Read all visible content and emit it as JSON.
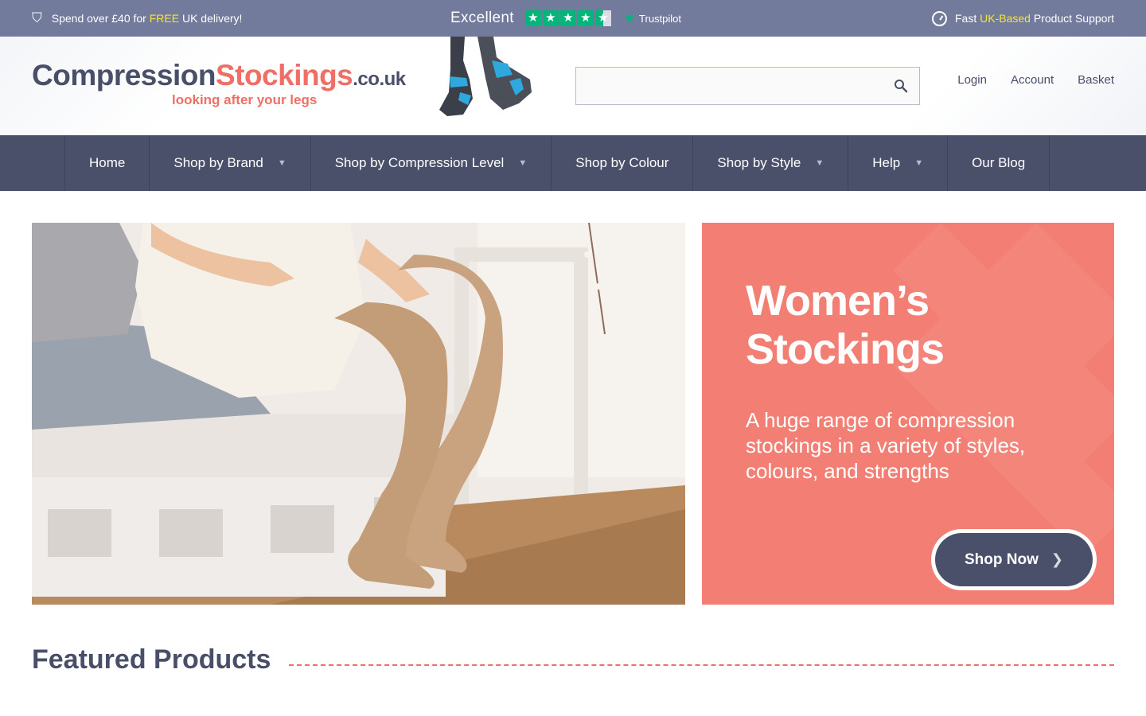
{
  "topbar": {
    "promo_prefix": "Spend over £40 for ",
    "promo_highlight": "FREE",
    "promo_suffix": " UK delivery!",
    "rating_label": "Excellent",
    "trustpilot": "Trustpilot",
    "stars": 4.5,
    "support_prefix": "Fast ",
    "support_highlight": "UK-Based",
    "support_suffix": " Product Support"
  },
  "header": {
    "logo_part1": "Compression",
    "logo_part2": "Stockings",
    "logo_part3": ".co.uk",
    "tagline": "looking after your legs",
    "search_value": "",
    "links": [
      "Login",
      "Account",
      "Basket"
    ]
  },
  "nav": {
    "items": [
      {
        "label": "Home",
        "dropdown": false
      },
      {
        "label": "Shop by Brand",
        "dropdown": true
      },
      {
        "label": "Shop by Compression Level",
        "dropdown": true
      },
      {
        "label": "Shop by Colour",
        "dropdown": false
      },
      {
        "label": "Shop by Style",
        "dropdown": true
      },
      {
        "label": "Help",
        "dropdown": true
      },
      {
        "label": "Our Blog",
        "dropdown": false
      }
    ]
  },
  "hero": {
    "title_line1": "Women’s",
    "title_line2": "Stockings",
    "description": "A huge range of compression stockings in a variety of styles, colours, and strengths",
    "cta": "Shop Now"
  },
  "featured": {
    "title": "Featured Products"
  },
  "colors": {
    "topbar": "#727b9c",
    "nav": "#4a5069",
    "accent": "#ef6e66",
    "highlight": "#f5e53b",
    "hero_panel": "#f37e73",
    "trustpilot_green": "#00b67a"
  }
}
